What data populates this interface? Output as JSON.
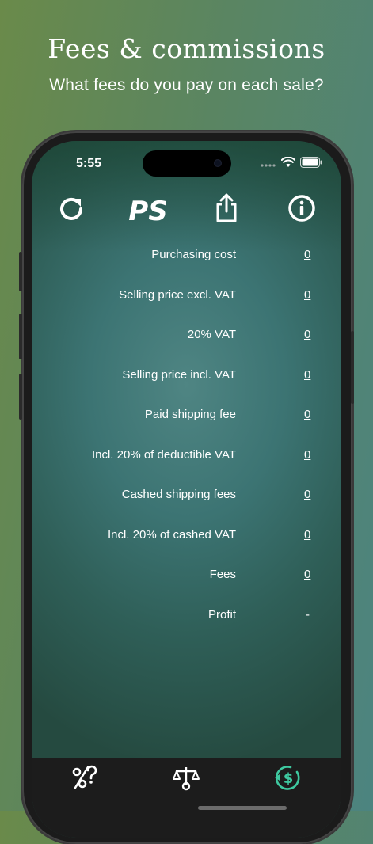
{
  "header": {
    "title": "Fees & commissions",
    "subtitle": "What fees do you pay on each sale?"
  },
  "status_bar": {
    "time": "5:55",
    "icons": [
      "signal-dots-icon",
      "wifi-icon",
      "battery-icon"
    ]
  },
  "toolbar": {
    "refresh_icon": "refresh-icon",
    "logo_text": "PS",
    "share_icon": "share-icon",
    "info_icon": "info-icon"
  },
  "rows": [
    {
      "label": "Purchasing cost",
      "value": "0"
    },
    {
      "label": "Selling price excl. VAT",
      "value": "0"
    },
    {
      "label": "20% VAT",
      "value": "0"
    },
    {
      "label": "Selling price incl. VAT",
      "value": "0"
    },
    {
      "label": "Paid shipping fee",
      "value": "0"
    },
    {
      "label": "Incl. 20% of deductible VAT",
      "value": "0"
    },
    {
      "label": "Cashed shipping fees",
      "value": "0"
    },
    {
      "label": "Incl. 20% of cashed VAT",
      "value": "0"
    },
    {
      "label": "Fees",
      "value": "0"
    },
    {
      "label": "Profit",
      "value": "-"
    }
  ],
  "tabbar": {
    "tabs": [
      {
        "icon": "percent-question-icon",
        "active": false
      },
      {
        "icon": "balance-scale-icon",
        "active": false
      },
      {
        "icon": "dollar-refresh-icon",
        "active": true
      }
    ],
    "active_color": "#3ec9a0"
  },
  "colors": {
    "background_left": "#6a8a4a",
    "background_right": "#4c8480",
    "tabbar": "#1c1c1c"
  }
}
